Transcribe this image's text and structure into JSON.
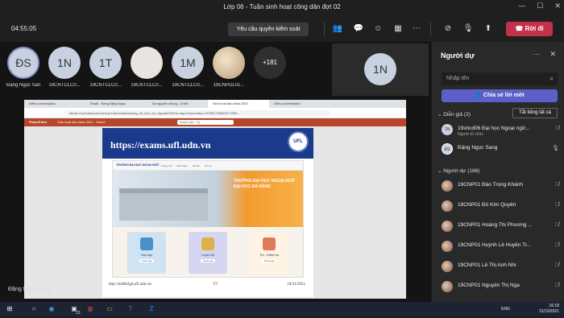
{
  "window": {
    "title": "Lớp 06 - Tuần sinh hoạt công dân đợt 02"
  },
  "toolbar": {
    "timer": "04:55:05",
    "request_control": "Yêu cầu quyền kiểm soát",
    "leave": "Rời đi"
  },
  "tiles": [
    {
      "initials": "ĐS",
      "name": "Đặng Ngọc Sang"
    },
    {
      "initials": "1N",
      "name": "19CNTCLC0..."
    },
    {
      "initials": "1T",
      "name": "19CNTCLC0..."
    },
    {
      "initials": "",
      "name": "19CNTCLC0..."
    },
    {
      "initials": "1M",
      "name": "19CNTCLC0..."
    },
    {
      "initials": "",
      "name": "19CNPDL01..."
    },
    {
      "initials": "+181",
      "name": ""
    }
  ],
  "pinned": {
    "initials": "1N"
  },
  "browser": {
    "tabs": [
      "Kiểm conversation",
      "Email - Sang Đặng Ngọc",
      "Tài nguyên chung - OneD",
      "Sinh hoạt đầu khóa 2021",
      "Kiểm conversation"
    ],
    "address": "ufludn-my.sharepoint.com/:p:/r/personal/dnsang_ufl_udn_vn/_layouts/15/Doc.aspx?sourcedoc=%7B317DA0037-0052-...",
    "ppt_app": "PowerPoint",
    "ppt_doc": "Sinh hoạt đầu khóa 2021 ·  Saved",
    "ppt_search": "Search (Alt + Q)"
  },
  "slide": {
    "url": "https://exams.ufl.udn.vn",
    "logo": "UFL",
    "site_logo": "TRƯỜNG ĐẠI HỌC NGOẠI NGỮ",
    "site_menu": [
      "Trang chủ",
      "Giới thiệu",
      "Tài liệu",
      "Hỗ trợ"
    ],
    "hero_text_1": "TRƯỜNG ĐẠI HỌC NGOẠI NGỮ",
    "hero_text_2": "ĐẠI HỌC ĐÀ NẴNG",
    "cards": [
      {
        "label": "Học tập",
        "btn": "Tham gia"
      },
      {
        "label": "Luyện thi",
        "btn": "Tham gia"
      },
      {
        "label": "Thi - Kiểm tra",
        "btn": "Tham gia"
      }
    ],
    "footer_url": "http://khdbclgd.ufl.udn.vn/",
    "page_number": "15",
    "date": "10/31/2021"
  },
  "presenter": "Đặng Ngọc Sang",
  "panel": {
    "title": "Người dự",
    "search_placeholder": "Nhập tên",
    "share_invite": "Chia sẻ lời mời",
    "presenters_label": "Diễn giả (2)",
    "mute_all": "Tắt tiếng tất cả",
    "attendees_label": "Người dự (186)",
    "presenters": [
      {
        "initials": "1N",
        "name": "19shcd06 Đại học Ngoại ngữ...",
        "sub": "Người tổ chức"
      },
      {
        "initials": "ĐS",
        "name": "Đặng Ngọc Sang",
        "sub": ""
      }
    ],
    "attendees": [
      "19CNP01 Đào Trọng Khánh",
      "19CNP01 Đỗ Kim Quyên",
      "19CNP01 Hoàng Thị Phương ...",
      "19CNP01 Huỳnh Lê Huyền Tr...",
      "19CNP01 Lê Thị Anh Nhi",
      "19CNP01 Nguyễn Thị Nga"
    ]
  },
  "taskbar": {
    "lang": "ENG",
    "time": "16:18",
    "date": "31/10/2021",
    "badge": "23"
  }
}
